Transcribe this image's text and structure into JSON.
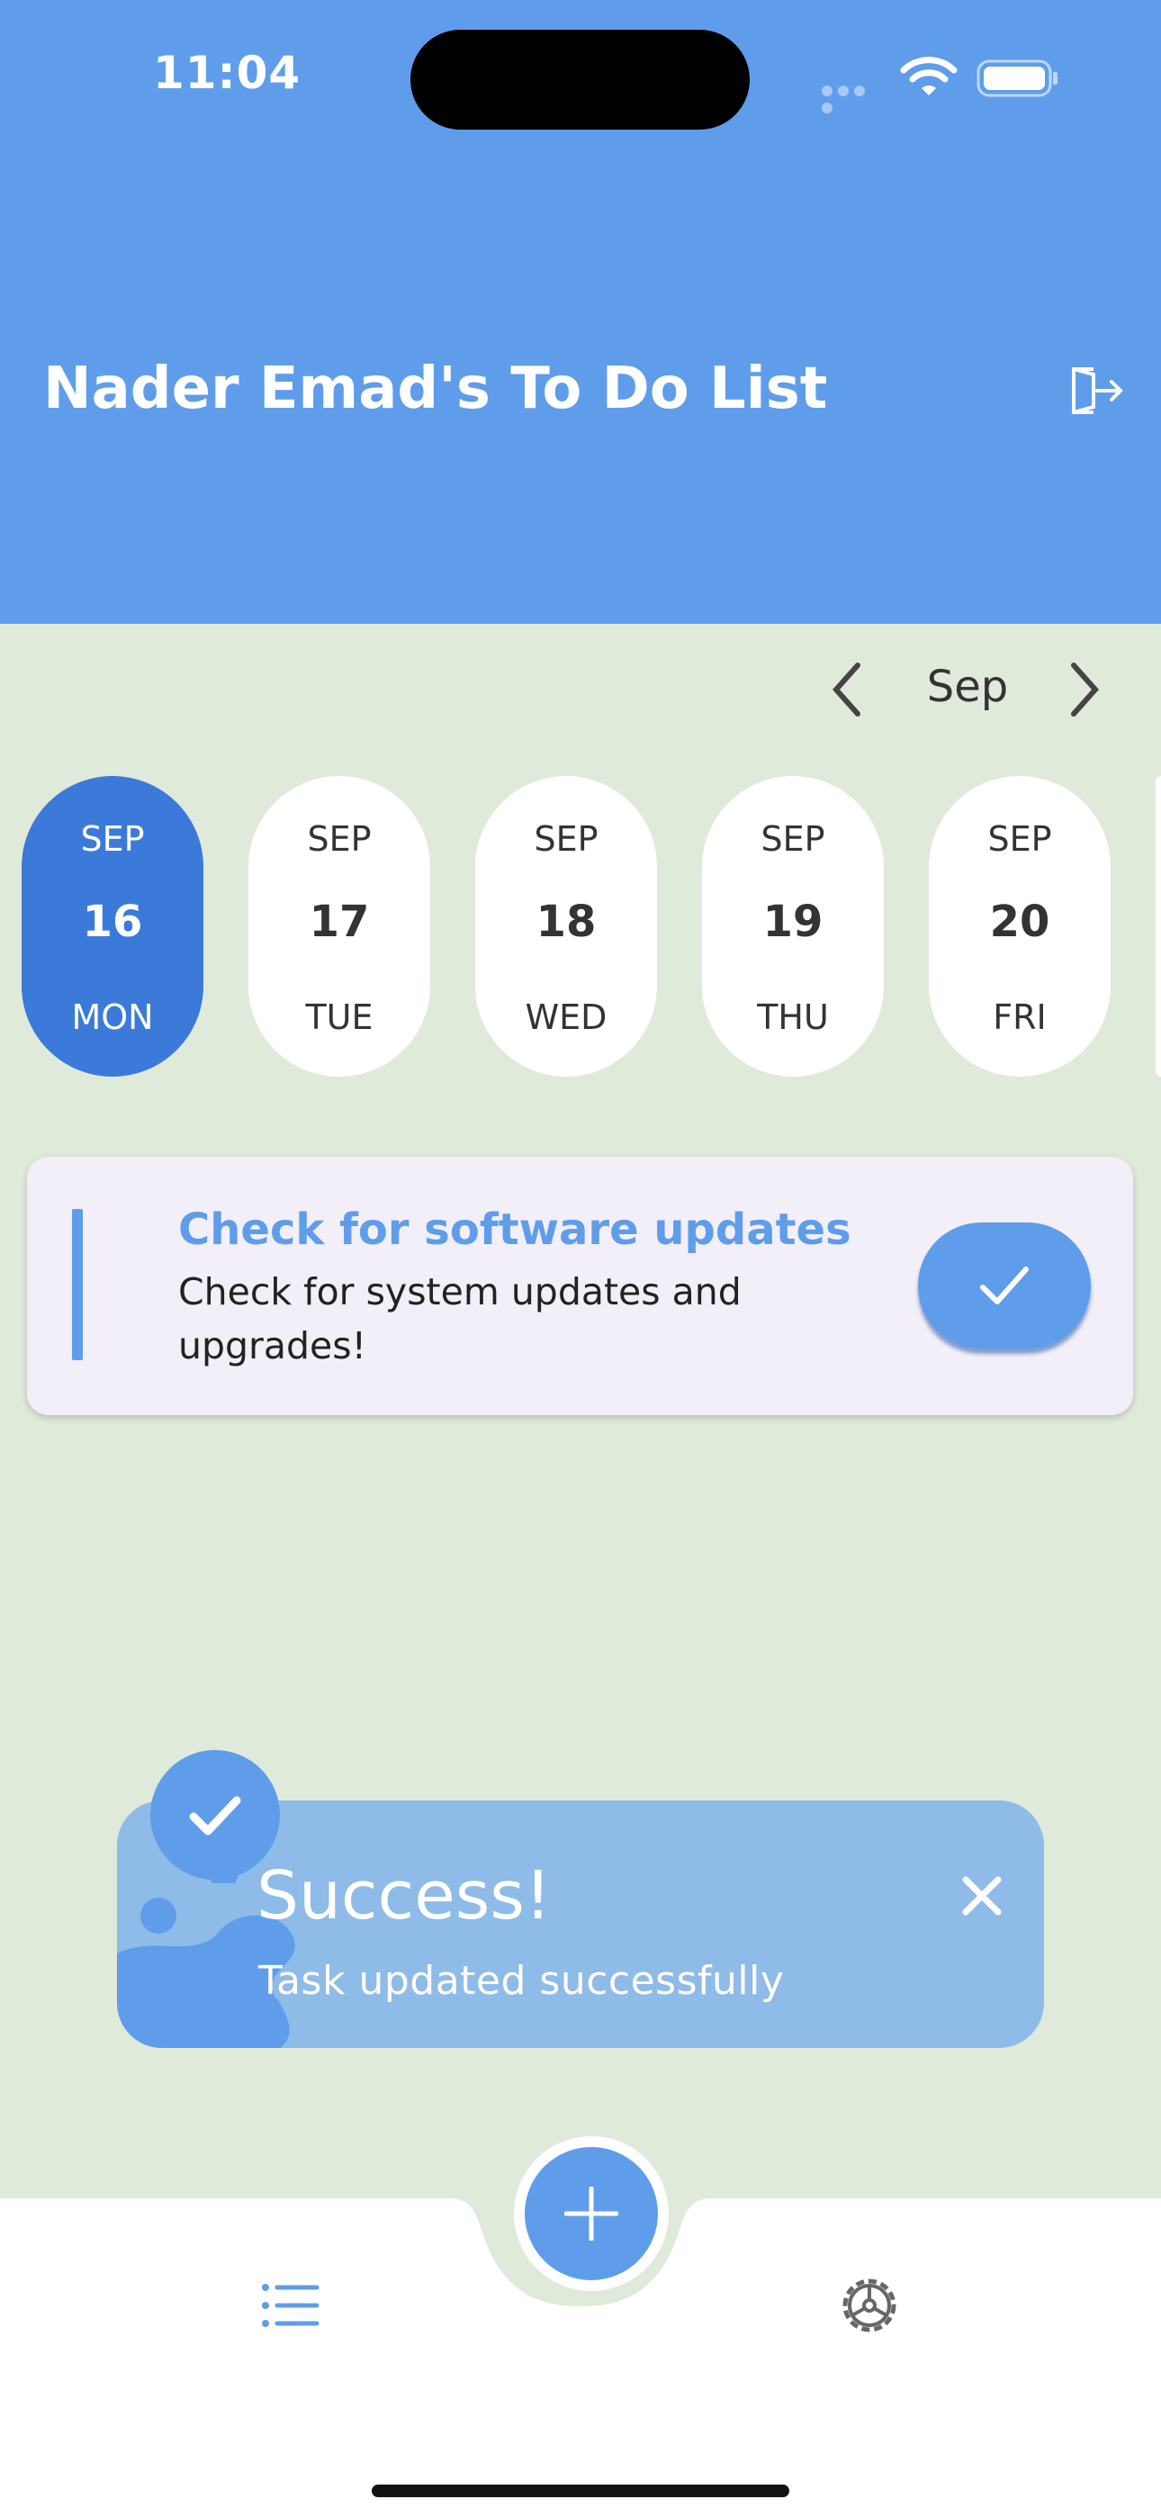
{
  "status_bar": {
    "time": "11:04"
  },
  "header": {
    "title": "Nader Emad's To Do List",
    "logout_icon": "logout-icon"
  },
  "month_nav": {
    "label": "Sep"
  },
  "dates": [
    {
      "month": "SEP",
      "day": "16",
      "weekday": "MON",
      "selected": true
    },
    {
      "month": "SEP",
      "day": "17",
      "weekday": "TUE",
      "selected": false
    },
    {
      "month": "SEP",
      "day": "18",
      "weekday": "WED",
      "selected": false
    },
    {
      "month": "SEP",
      "day": "19",
      "weekday": "THU",
      "selected": false
    },
    {
      "month": "SEP",
      "day": "20",
      "weekday": "FRI",
      "selected": false
    }
  ],
  "task": {
    "title": "Check for software updates",
    "description": "Check for system updates and upgrades!"
  },
  "toast": {
    "title": "Success!",
    "message": "Task updated successfully"
  },
  "bottom_nav": {
    "items": [
      "list-icon",
      "settings-icon"
    ],
    "add_icon": "plus-icon"
  },
  "colors": {
    "primary": "#5f9deb",
    "selected_date": "#3b7ad9",
    "background": "#dfeadb",
    "toast": "#8fbbe8",
    "task_card": "#f3eff8"
  }
}
